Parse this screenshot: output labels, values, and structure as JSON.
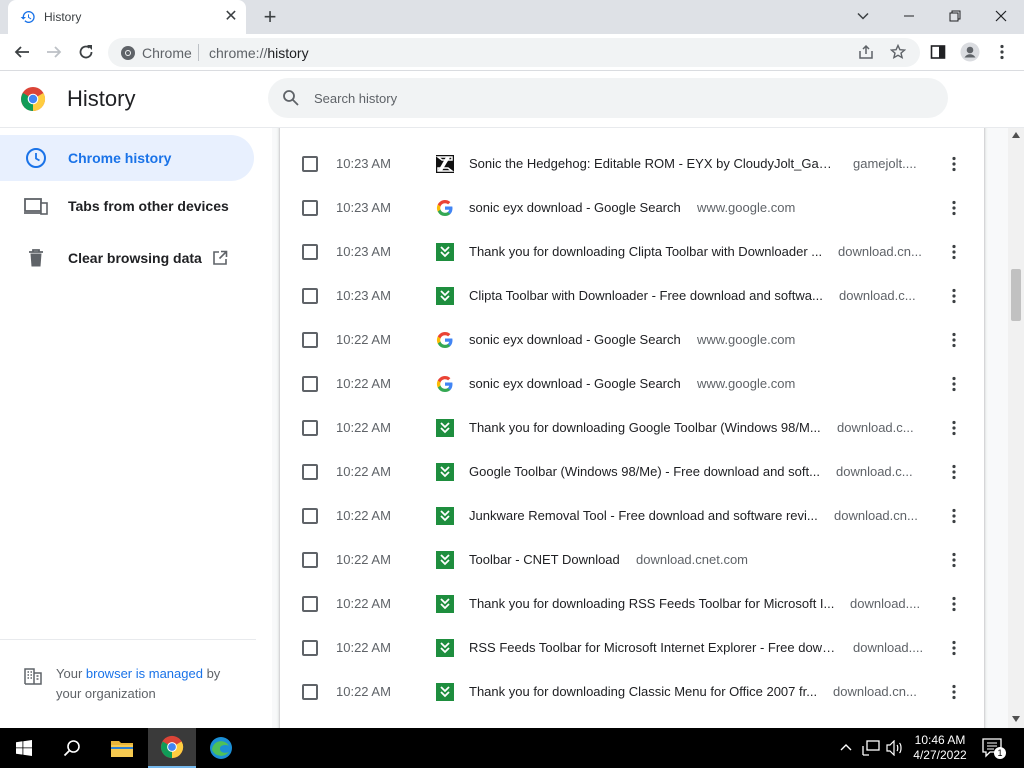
{
  "tab": {
    "title": "History",
    "close": "✕",
    "new_tab": "+"
  },
  "omnibox": {
    "chip_label": "Chrome",
    "url_prefix": "chrome://",
    "url_path": "history"
  },
  "page": {
    "title": "History",
    "search_placeholder": "Search history"
  },
  "sidebar": {
    "items": [
      {
        "label": "Chrome history",
        "icon": "clock-icon"
      },
      {
        "label": "Tabs from other devices",
        "icon": "devices-icon"
      },
      {
        "label": "Clear browsing data",
        "icon": "trash-icon"
      }
    ],
    "managed": {
      "prefix": "Your ",
      "link": "browser is managed",
      "suffix": " by your organization"
    }
  },
  "history": [
    {
      "time": "10:23 AM",
      "favicon": "gamejolt",
      "title": "Sonic the Hedgehog: Editable ROM - EYX by CloudyJolt_Game...",
      "domain": "gamejolt...."
    },
    {
      "time": "10:23 AM",
      "favicon": "google",
      "title": "sonic eyx download - Google Search",
      "domain": "www.google.com"
    },
    {
      "time": "10:23 AM",
      "favicon": "cnet",
      "title": "Thank you for downloading Clipta Toolbar with Downloader ...",
      "domain": "download.cn..."
    },
    {
      "time": "10:23 AM",
      "favicon": "cnet",
      "title": "Clipta Toolbar with Downloader - Free download and softwa...",
      "domain": "download.c..."
    },
    {
      "time": "10:22 AM",
      "favicon": "google",
      "title": "sonic eyx download - Google Search",
      "domain": "www.google.com"
    },
    {
      "time": "10:22 AM",
      "favicon": "google",
      "title": "sonic eyx download - Google Search",
      "domain": "www.google.com"
    },
    {
      "time": "10:22 AM",
      "favicon": "cnet",
      "title": "Thank you for downloading Google Toolbar (Windows 98/M...",
      "domain": "download.c..."
    },
    {
      "time": "10:22 AM",
      "favicon": "cnet",
      "title": "Google Toolbar (Windows 98/Me) - Free download and soft...",
      "domain": "download.c..."
    },
    {
      "time": "10:22 AM",
      "favicon": "cnet",
      "title": "Junkware Removal Tool - Free download and software revi...",
      "domain": "download.cn..."
    },
    {
      "time": "10:22 AM",
      "favicon": "cnet",
      "title": "Toolbar - CNET Download",
      "domain": "download.cnet.com"
    },
    {
      "time": "10:22 AM",
      "favicon": "cnet",
      "title": "Thank you for downloading RSS Feeds Toolbar for Microsoft I...",
      "domain": "download...."
    },
    {
      "time": "10:22 AM",
      "favicon": "cnet",
      "title": "RSS Feeds Toolbar for Microsoft Internet Explorer - Free down...",
      "domain": "download...."
    },
    {
      "time": "10:22 AM",
      "favicon": "cnet",
      "title": "Thank you for downloading Classic Menu for Office 2007 fr...",
      "domain": "download.cn..."
    }
  ],
  "taskbar": {
    "time": "10:46 AM",
    "date": "4/27/2022",
    "notification_count": "1"
  },
  "colors": {
    "accent": "#1a73e8",
    "cnet_green": "#1e8e3e",
    "active_bg": "#e8f0fe"
  }
}
